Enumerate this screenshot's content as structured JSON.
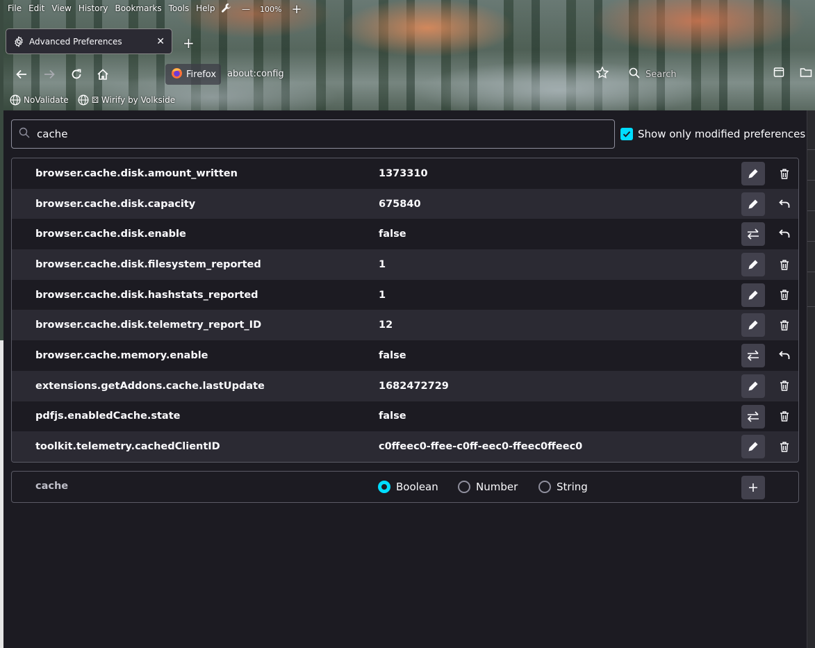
{
  "menubar": {
    "items": [
      "File",
      "Edit",
      "View",
      "History",
      "Bookmarks",
      "Tools",
      "Help"
    ],
    "zoom_minus": "—",
    "zoom_level": "100%",
    "zoom_plus": "+"
  },
  "tab": {
    "title": "Advanced Preferences",
    "close": "✕",
    "new_tab": "+"
  },
  "navbar": {
    "identity_label": "Firefox",
    "url": "about:config",
    "search_placeholder": "Search"
  },
  "bookmarks": [
    {
      "label": "NoValidate"
    },
    {
      "label": "⚄ Wirify by Volkside"
    }
  ],
  "search": {
    "value": "cache"
  },
  "modified_toggle": {
    "label": "Show only modified preferences",
    "checked": true
  },
  "prefs": [
    {
      "name": "browser.cache.disk.amount_written",
      "value": "1373310",
      "action": "edit",
      "secondary": "delete"
    },
    {
      "name": "browser.cache.disk.capacity",
      "value": "675840",
      "action": "edit",
      "secondary": "reset"
    },
    {
      "name": "browser.cache.disk.enable",
      "value": "false",
      "action": "toggle",
      "secondary": "reset"
    },
    {
      "name": "browser.cache.disk.filesystem_reported",
      "value": "1",
      "action": "edit",
      "secondary": "delete"
    },
    {
      "name": "browser.cache.disk.hashstats_reported",
      "value": "1",
      "action": "edit",
      "secondary": "delete"
    },
    {
      "name": "browser.cache.disk.telemetry_report_ID",
      "value": "12",
      "action": "edit",
      "secondary": "delete"
    },
    {
      "name": "browser.cache.memory.enable",
      "value": "false",
      "action": "toggle",
      "secondary": "reset"
    },
    {
      "name": "extensions.getAddons.cache.lastUpdate",
      "value": "1682472729",
      "action": "edit",
      "secondary": "delete"
    },
    {
      "name": "pdfjs.enabledCache.state",
      "value": "false",
      "action": "toggle",
      "secondary": "delete"
    },
    {
      "name": "toolkit.telemetry.cachedClientID",
      "value": "c0ffeec0-ffee-c0ff-eec0-ffeec0ffeec0",
      "action": "edit",
      "secondary": "delete"
    }
  ],
  "add_row": {
    "name": "cache",
    "types": [
      "Boolean",
      "Number",
      "String"
    ],
    "selected": "Boolean"
  },
  "colors": {
    "accent": "#00ddff",
    "background": "#1c1b22",
    "row_alt": "#2b2a33",
    "button": "#42414d"
  }
}
